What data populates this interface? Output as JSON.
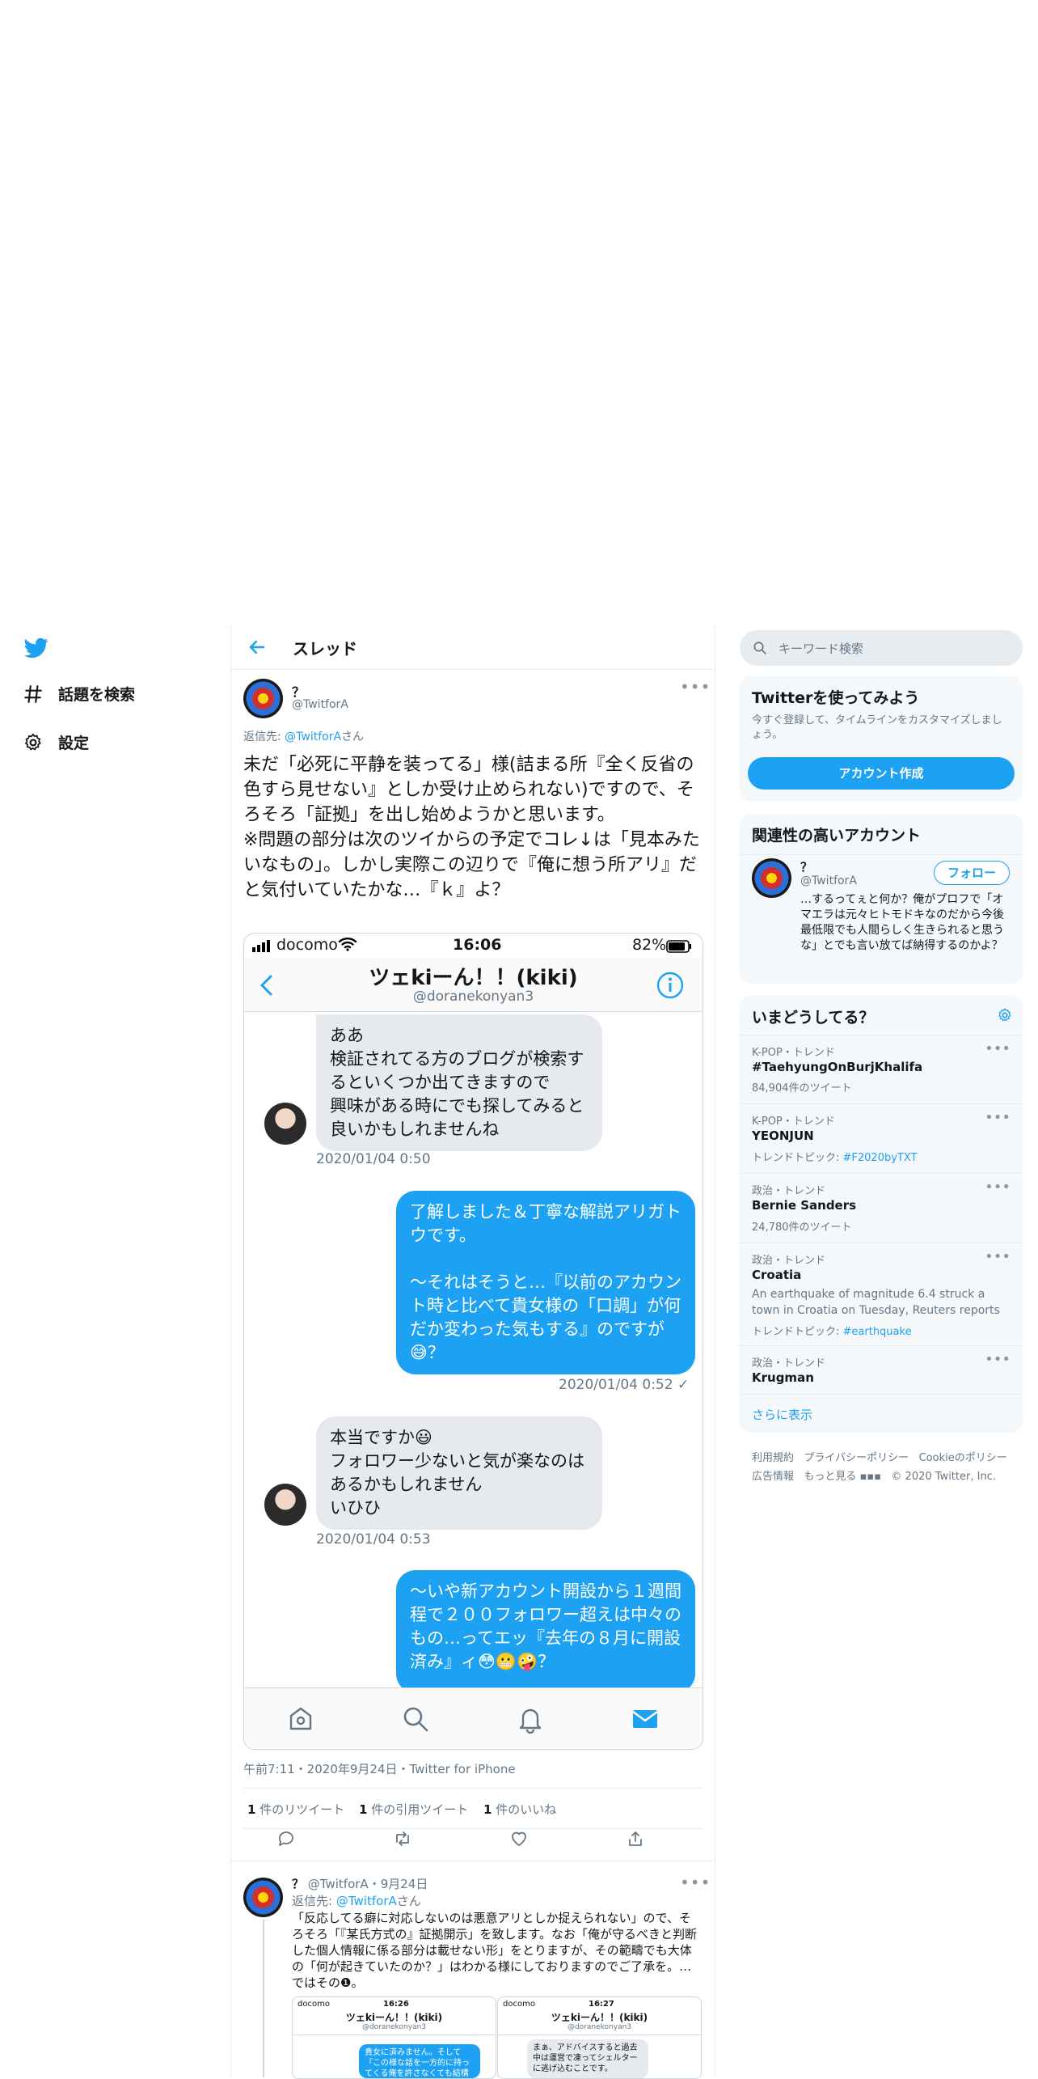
{
  "nav": {
    "explore_label": "話題を検索",
    "settings_label": "設定"
  },
  "thread": {
    "header_title": "スレッド",
    "author_name": "？",
    "author_handle": "@TwitforA",
    "replying_prefix": "返信先: ",
    "replying_handle": "@TwitforA",
    "replying_suffix": "さん",
    "text": "未だ「必死に平静を装ってる」様(詰まる所『全く反省の色すら見せない』としか受け止められない)ですので、そろそろ「証拠」を出し始めようかと思います。\n※問題の部分は次のツイからの予定でコレ↓は「見本みたいなもの」。しかし実際この辺りで『俺に想う所アリ』だと気付いていたかな…『ｋ』よ？",
    "meta": "午前7:11・2020年9月24日・Twitter for iPhone",
    "retweets_count": "1",
    "retweets_label": " 件のリツイート",
    "quotes_count": "1",
    "quotes_label": " 件の引用ツイート",
    "likes_count": "1",
    "likes_label": " 件のいいね"
  },
  "screenshot": {
    "carrier": "docomo",
    "time": "16:06",
    "battery": "82%",
    "chat_title": "ツェkiーん！！(kiki)",
    "chat_handle": "@doranekonyan3",
    "messages": [
      {
        "text": "ああ\n検証されてる方のブログが検索するといくつか出てきますので\n興味がある時にでも探してみると良いかもしれませんね",
        "time": "2020/01/04 0:50"
      },
      {
        "text": "了解しました＆丁寧な解説アリガトウです。\n\n〜それはそうと…『以前のアカウント時と比べて貴女様の「口調」が何だか変わった気もする』のですが😅？",
        "time": "2020/01/04 0:52 ✓"
      },
      {
        "text": "本当ですか😃\nフォロワー少ないと気が楽なのはあるかもしれません\nいひひ",
        "time": "2020/01/04 0:53"
      },
      {
        "text": "〜いや新アカウント開設から１週間程で２００フォロワー超えは中々のもの…ってエッ『去年の８月に開設済み』ィ😳😬🤪？"
      }
    ]
  },
  "reply": {
    "author_name": "？",
    "author_handle": "@TwitforA",
    "date": "・9月24日",
    "replying_prefix": "返信先: ",
    "replying_handle": "@TwitforA",
    "replying_suffix": "さん",
    "text": "「反応してる癖に対応しないのは悪意アリとしか捉えられない」ので、そろそろ「『某氏方式の』証拠開示」を致します。なお「俺が守るべきと判断した個人情報に係る部分は載せない形」をとりますが、その範疇でも大体の「何が起きていたのか？」はわかる様にしておりますのでご了承を。…ではその❶。",
    "mini1_time": "16:26",
    "mini1_title": "ツェkiーん！！(kiki)",
    "mini1_handle": "@doranekonyan3",
    "mini1_msg": "貴女に済みません。そして『この様な話を一方的に持ってくる俺を許さなくても結構ですので』何卒",
    "mini2_time": "16:27",
    "mini2_title": "ツェkiーん！！(kiki)",
    "mini2_handle": "@doranekonyan3",
    "mini2_msg": "まぁ、アドバイスすると過去中は運営で凍ってシェルターに逃げ込むことです。"
  },
  "sidebar": {
    "search_placeholder": "キーワード検索",
    "signup_title": "Twitterを使ってみよう",
    "signup_desc": "今すぐ登録して、タイムラインをカスタマイズしましょう。",
    "signup_button": "アカウント作成",
    "related_title": "関連性の高いアカウント",
    "related_name": "？",
    "related_handle": "@TwitforA",
    "follow_button": "フォロー",
    "related_bio": "…するってぇと何か？俺がプロフで「オマエラは元々ヒトモドキなのだから今後最低限でも人間らしく生きられると思うな」とでも言い放てば納得するのかよ？",
    "trends_title": "いまどうしてる？",
    "trends": [
      {
        "meta": "K-POP・トレンド",
        "name": "#TaehyungOnBurjKhalifa",
        "desc": "",
        "sub": "84,904件のツイート",
        "topic_label": "",
        "topic_link": ""
      },
      {
        "meta": "K-POP・トレンド",
        "name": "YEONJUN",
        "desc": "",
        "sub": "",
        "topic_label": "トレンドトピック: ",
        "topic_link": "#F2020byTXT"
      },
      {
        "meta": "政治・トレンド",
        "name": "Bernie Sanders",
        "desc": "",
        "sub": "24,780件のツイート",
        "topic_label": "",
        "topic_link": ""
      },
      {
        "meta": "政治・トレンド",
        "name": "Croatia",
        "desc": "An earthquake of magnitude 6.4 struck a town in Croatia on Tuesday, Reuters reports",
        "sub": "",
        "topic_label": "トレンドトピック: ",
        "topic_link": "#earthquake"
      },
      {
        "meta": "政治・トレンド",
        "name": "Krugman",
        "desc": "",
        "sub": "",
        "topic_label": "",
        "topic_link": ""
      }
    ],
    "show_more": "さらに表示",
    "footer_line1": [
      "利用規約",
      "プライバシーポリシー",
      "Cookieのポリシー"
    ],
    "footer_line2": [
      "広告情報",
      "もっと見る",
      "© 2020 Twitter, Inc."
    ]
  },
  "colors": {
    "accent": "#1da1f2",
    "text": "#14171a",
    "muted": "#657786",
    "panel": "#f5f8fa",
    "border": "#e6ecf0"
  }
}
